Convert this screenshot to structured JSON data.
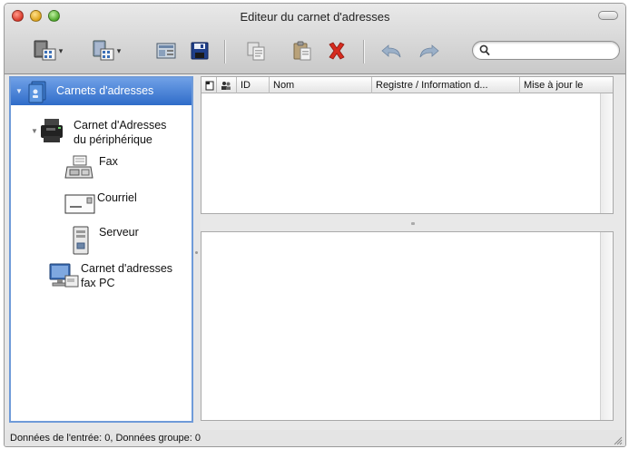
{
  "window": {
    "title": "Editeur du carnet d'adresses"
  },
  "toolbar": {
    "buttons": [
      {
        "name": "new-address-book-button",
        "icon": "new-address-book-icon"
      },
      {
        "name": "new-group-button",
        "icon": "new-group-icon"
      },
      {
        "name": "edit-button",
        "icon": "edit-icon"
      },
      {
        "name": "save-button",
        "icon": "save-icon"
      },
      {
        "name": "copy-button",
        "icon": "copy-icon"
      },
      {
        "name": "paste-button",
        "icon": "paste-icon"
      },
      {
        "name": "delete-button",
        "icon": "delete-icon"
      },
      {
        "name": "undo-button",
        "icon": "undo-icon"
      },
      {
        "name": "redo-button",
        "icon": "redo-icon"
      }
    ],
    "search": {
      "value": "",
      "placeholder": ""
    }
  },
  "sidebar": {
    "items": [
      {
        "label": "Carnets d'adresses",
        "icon": "address-books-icon",
        "selected": true
      },
      {
        "label_line1": "Carnet d'Adresses",
        "label_line2": "du périphérique",
        "icon": "printer-icon"
      },
      {
        "label": "Fax",
        "icon": "fax-icon"
      },
      {
        "label": "Courriel",
        "icon": "email-icon"
      },
      {
        "label": "Serveur",
        "icon": "server-icon"
      },
      {
        "label_line1": "Carnet d'adresses",
        "label_line2": "fax PC",
        "icon": "pc-fax-icon"
      }
    ]
  },
  "table": {
    "columns": [
      {
        "label": "",
        "icon": "entry-type-icon"
      },
      {
        "label": "",
        "icon": "group-icon"
      },
      {
        "label": "ID"
      },
      {
        "label": "Nom"
      },
      {
        "label": "Registre / Information d..."
      },
      {
        "label": "Mise à jour le"
      }
    ],
    "rows": []
  },
  "status": {
    "text": "Données de l'entrée: 0, Données groupe: 0"
  },
  "colors": {
    "selection_top": "#6fa0e6",
    "selection_bottom": "#2f6cc9",
    "sidebar_border": "#6f9bd9",
    "delete_red": "#d62b1f"
  }
}
